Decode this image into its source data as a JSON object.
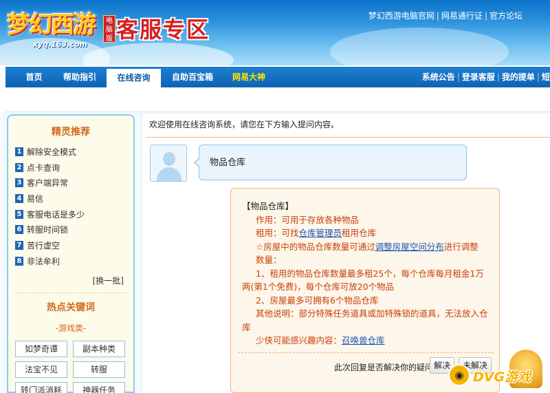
{
  "header": {
    "logo_text": "梦幻西游",
    "logo_badge": "电脑版",
    "logo_url": "xyq.163.com",
    "zone_title": "客服专区",
    "top_links": [
      "梦幻西游电脑官网",
      "网易通行证",
      "官方论坛"
    ]
  },
  "nav": {
    "items": [
      "首页",
      "帮助指引",
      "在线咨询",
      "自助百宝箱",
      "网易大神"
    ],
    "active": "在线咨询",
    "right_links": [
      "系统公告",
      "登录客服",
      "我的提单",
      "短"
    ]
  },
  "sidebar": {
    "recommend_title": "精灵推荐",
    "recommend_items": [
      "解除安全模式",
      "点卡查询",
      "客户端异常",
      "易信",
      "客服电话是多少",
      "转服时间锁",
      "苦行虚空",
      "非法牟利"
    ],
    "more_label": "[换一批]",
    "hot_title": "热点关键词",
    "category": "-游戏类-",
    "keywords": [
      "如梦奇谭",
      "副本种类",
      "法宝不见",
      "转服",
      "转门派消耗",
      "神器任务"
    ]
  },
  "main": {
    "welcome": "欢迎使用在线咨询系统，请您在下方输入提问内容。",
    "user_message": "物品仓库",
    "answer": {
      "title": "【物品仓库】",
      "line1": "作用：可用于存放各种物品",
      "line2_prefix": "租用：可找",
      "line2_link": "仓库管理员",
      "line2_suffix": "租用仓库",
      "line3_prefix": "☆房屋中的物品仓库数量可通过",
      "line3_link": "调整房屋空间分布",
      "line3_suffix": "进行调整",
      "line4": "数量：",
      "line5": "1、租用的物品仓库数量最多租25个，每个仓库每月租金1万",
      "line6": "两(第1个免费)，每个仓库可放20个物品",
      "line7": "2、房屋最多可拥有6个物品仓库",
      "line8": "其他说明：部分特殊任务道具或加特殊锁的道具，无法放入仓",
      "line9": "库",
      "line10_prefix": "少侠可能感兴趣内容：",
      "line10_link": "召唤兽仓库"
    },
    "feedback_question": "此次回复是否解决你的疑问:",
    "btn_solved": "解决",
    "btn_unsolved": "未解决"
  },
  "watermark": {
    "text": "DVG游戏",
    "icon": "gamepad-icon"
  }
}
